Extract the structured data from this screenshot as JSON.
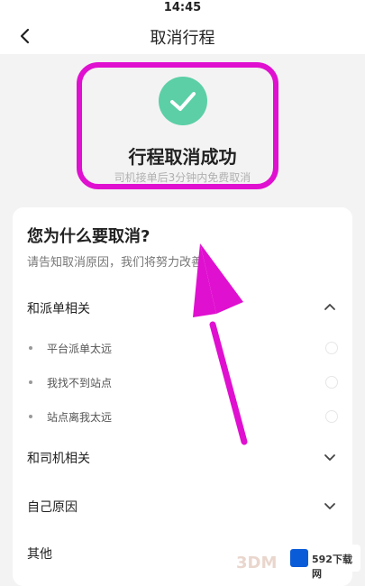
{
  "status_bar": {
    "time": "14:45"
  },
  "nav": {
    "title": "取消行程",
    "back_icon": "chevron-left-icon"
  },
  "success": {
    "title": "行程取消成功",
    "subtitle": "司机接单后3分钟内免费取消",
    "icon": "check-icon",
    "color": "#5ccfa6"
  },
  "reasons": {
    "title": "您为什么要取消?",
    "subtitle": "请告知取消原因，我们将努力改善",
    "sections": [
      {
        "label": "和派单相关",
        "expanded": true,
        "items": [
          {
            "label": "平台派单太远"
          },
          {
            "label": "我找不到站点"
          },
          {
            "label": "站点离我太远"
          }
        ]
      },
      {
        "label": "和司机相关",
        "expanded": false
      },
      {
        "label": "自己原因",
        "expanded": false
      },
      {
        "label": "其他",
        "expanded": false
      }
    ]
  },
  "annotation_color": "#e010d0",
  "watermark": {
    "brand": "592下载网",
    "mark": "3DM"
  }
}
